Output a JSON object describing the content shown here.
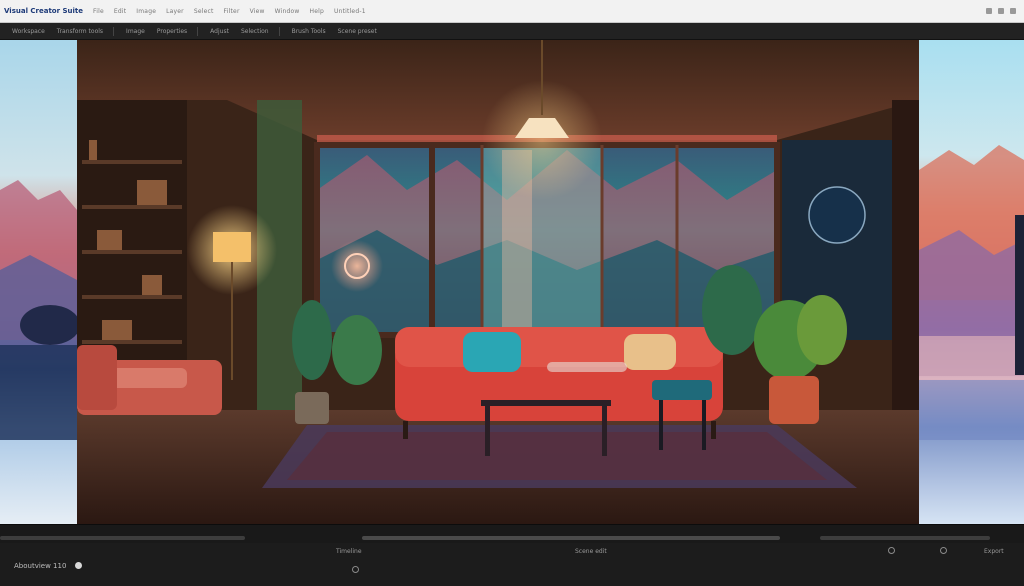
{
  "app": {
    "title": "Visual Creator Suite",
    "menu": [
      "File",
      "Edit",
      "Image",
      "Layer",
      "Select",
      "Filter",
      "View",
      "Window",
      "Help"
    ],
    "status": "Untitled-1"
  },
  "toolbar": {
    "items": [
      "Workspace",
      "Transform tools",
      "Image",
      "Properties",
      "Adjust",
      "Selection",
      "Brush Tools",
      "Scene preset"
    ]
  },
  "canvas": {
    "image_alt": "Lofi living room with red sofa, plants, lamp and moonlit window"
  },
  "footer": {
    "zoom": "Aboutview 110",
    "status_center": "Scene edit",
    "status_left": "Timeline",
    "status_right": "Export"
  },
  "colors": {
    "sofa": "#d8433a",
    "wall": "#3a2418",
    "window_sky": "#2c8a8a",
    "lamp": "#f4c06a",
    "accent": "#1d3a78"
  }
}
